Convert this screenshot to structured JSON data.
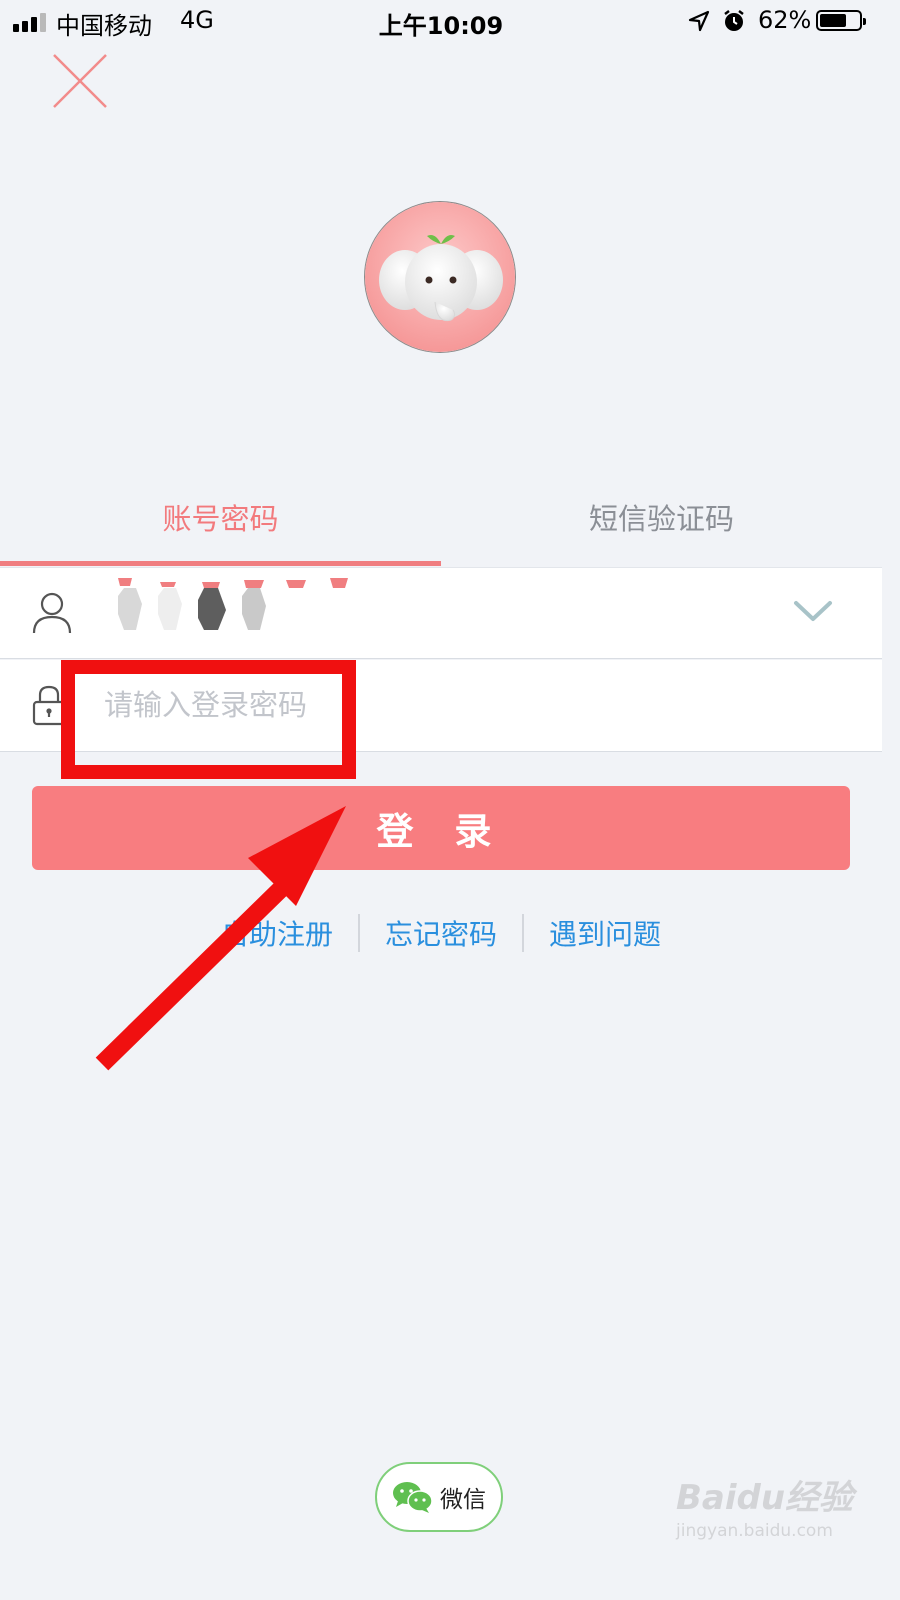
{
  "status_bar": {
    "carrier": "中国移动",
    "network": "4G",
    "time": "上午10:09",
    "battery": "62%",
    "battery_level": 0.62
  },
  "tabs": [
    {
      "label": "账号密码",
      "active": true
    },
    {
      "label": "短信验证码",
      "active": false
    }
  ],
  "form": {
    "username_masked": true,
    "password_placeholder": "请输入登录密码",
    "password_value": ""
  },
  "login_button": {
    "label": "登 录"
  },
  "links": [
    "自助注册",
    "忘记密码",
    "遇到问题"
  ],
  "wechat": {
    "label": "微信"
  },
  "watermark": {
    "main": "Baidu经验",
    "sub": "jingyan.baidu.com"
  },
  "colors": {
    "accent": "#f87d80",
    "link": "#2a8fde",
    "annotation": "#f01010",
    "wechat_green": "#7fcf7a"
  }
}
